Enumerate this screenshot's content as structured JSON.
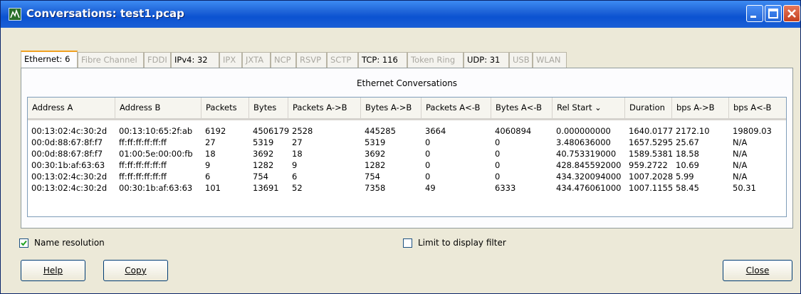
{
  "window": {
    "title": "Conversations: test1.pcap",
    "controls": [
      "minimize",
      "maximize",
      "close"
    ]
  },
  "tabs": [
    {
      "label": "Ethernet: 6",
      "enabled": true,
      "active": true
    },
    {
      "label": "Fibre Channel",
      "enabled": false
    },
    {
      "label": "FDDI",
      "enabled": false
    },
    {
      "label": "IPv4: 32",
      "enabled": true
    },
    {
      "label": "IPX",
      "enabled": false
    },
    {
      "label": "JXTA",
      "enabled": false
    },
    {
      "label": "NCP",
      "enabled": false
    },
    {
      "label": "RSVP",
      "enabled": false
    },
    {
      "label": "SCTP",
      "enabled": false
    },
    {
      "label": "TCP: 116",
      "enabled": true
    },
    {
      "label": "Token Ring",
      "enabled": false
    },
    {
      "label": "UDP: 31",
      "enabled": true
    },
    {
      "label": "USB",
      "enabled": false
    },
    {
      "label": "WLAN",
      "enabled": false
    }
  ],
  "table": {
    "title": "Ethernet Conversations",
    "columns": [
      "Address A",
      "Address B",
      "Packets",
      "Bytes",
      "Packets A->B",
      "Bytes A->B",
      "Packets A<-B",
      "Bytes A<-B",
      "Rel Start ⌄",
      "Duration",
      "bps A->B",
      "bps A<-B"
    ],
    "rows": [
      [
        "00:13:02:4c:30:2d",
        "00:13:10:65:2f:ab",
        "6192",
        "4506179",
        "2528",
        "445285",
        "3664",
        "4060894",
        "0.000000000",
        "1640.0177",
        "2172.10",
        "19809.03"
      ],
      [
        "00:0d:88:67:8f:f7",
        "ff:ff:ff:ff:ff:ff",
        "27",
        "5319",
        "27",
        "5319",
        "0",
        "0",
        "3.480636000",
        "1657.5295",
        "25.67",
        "N/A"
      ],
      [
        "00:0d:88:67:8f:f7",
        "01:00:5e:00:00:fb",
        "18",
        "3692",
        "18",
        "3692",
        "0",
        "0",
        "40.753319000",
        "1589.5381",
        "18.58",
        "N/A"
      ],
      [
        "00:30:1b:af:63:63",
        "ff:ff:ff:ff:ff:ff",
        "9",
        "1282",
        "9",
        "1282",
        "0",
        "0",
        "428.845592000",
        "959.2722",
        "10.69",
        "N/A"
      ],
      [
        "00:13:02:4c:30:2d",
        "ff:ff:ff:ff:ff:ff",
        "6",
        "754",
        "6",
        "754",
        "0",
        "0",
        "434.320094000",
        "1007.2028",
        "5.99",
        "N/A"
      ],
      [
        "00:13:02:4c:30:2d",
        "00:30:1b:af:63:63",
        "101",
        "13691",
        "52",
        "7358",
        "49",
        "6333",
        "434.476061000",
        "1007.1155",
        "58.45",
        "50.31"
      ]
    ]
  },
  "options": {
    "name_resolution": {
      "label": "Name resolution",
      "checked": true
    },
    "limit_filter": {
      "label": "Limit to display filter",
      "checked": false
    }
  },
  "buttons": {
    "help": "Help",
    "copy": "Copy",
    "close": "Close"
  }
}
